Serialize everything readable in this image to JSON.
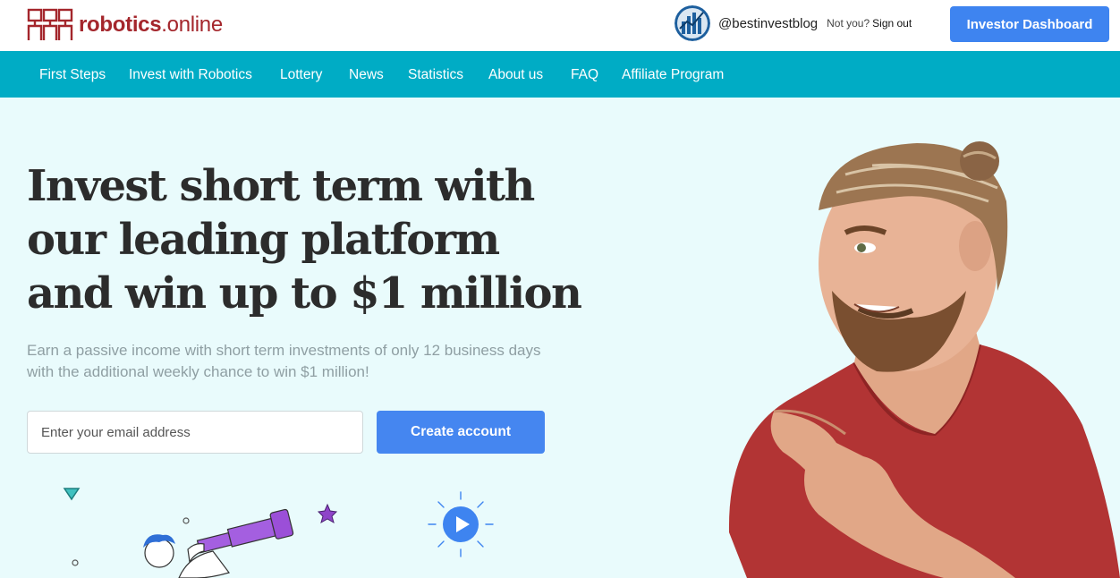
{
  "header": {
    "logo_bold": "robotics",
    "logo_rest": ".online",
    "username": "@bestinvestblog",
    "not_you": "Not you?",
    "sign_out": "Sign out",
    "dashboard_button": "Investor Dashboard"
  },
  "nav": {
    "items": [
      "First Steps",
      "Invest with Robotics",
      "Lottery",
      "News",
      "Statistics",
      "About us",
      "FAQ",
      "Affiliate Program"
    ]
  },
  "hero": {
    "headline_lines": [
      "Invest short term with",
      "our leading platform",
      "and win up to $1 million"
    ],
    "subtext_lines": [
      "Earn a passive income with short term investments of only 12 business days",
      "with the additional weekly chance to win $1 million!"
    ],
    "email_placeholder": "Enter your email address",
    "create_button": "Create account"
  },
  "colors": {
    "brand": "#a4262c",
    "nav_bg": "#00acc5",
    "page_bg": "#e9fbfc",
    "button": "#4586f0"
  },
  "icons": [
    "logo-icon",
    "avatar",
    "play-icon",
    "telescope-illustration",
    "star-icon",
    "triangle-icon"
  ]
}
